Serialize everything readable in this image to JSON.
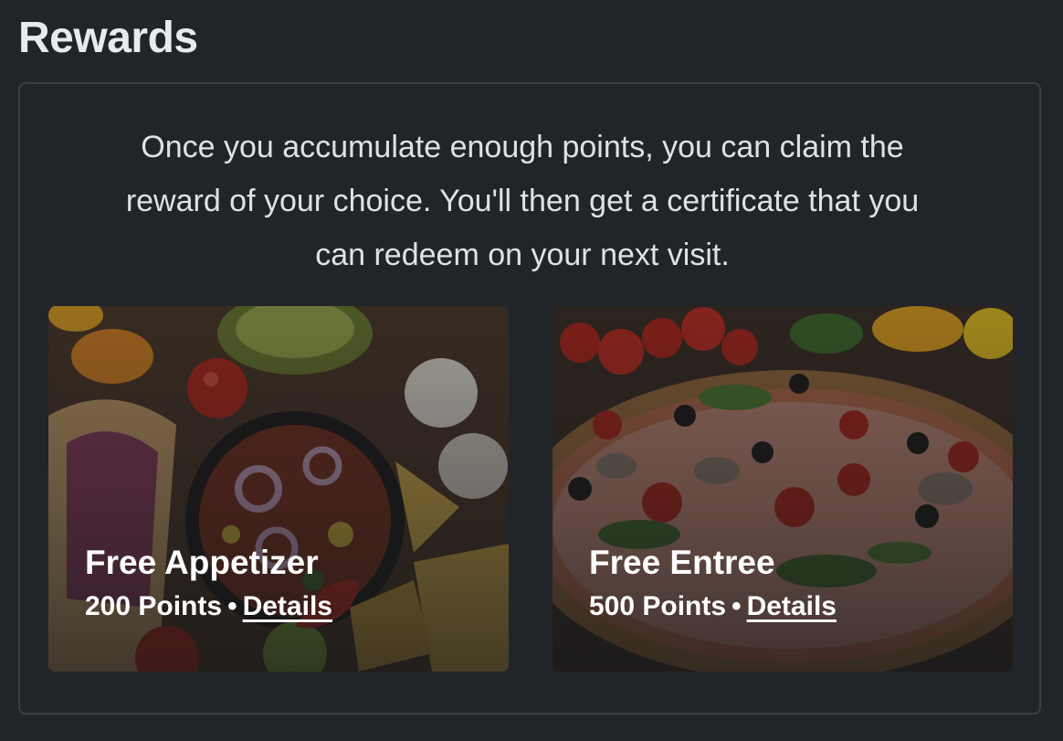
{
  "page": {
    "title": "Rewards"
  },
  "intro": {
    "text": "Once you accumulate enough points, you can claim the reward of your choice. You'll then get a certificate that you can redeem on your next visit."
  },
  "rewards": [
    {
      "title": "Free Appetizer",
      "points": "200 Points",
      "separator": "•",
      "details_label": "Details",
      "image": "appetizer-photo"
    },
    {
      "title": "Free Entree",
      "points": "500 Points",
      "separator": "•",
      "details_label": "Details",
      "image": "pizza-photo"
    }
  ],
  "colors": {
    "background": "#212529",
    "border": "#3a3f44",
    "text": "#e6e8ea"
  }
}
